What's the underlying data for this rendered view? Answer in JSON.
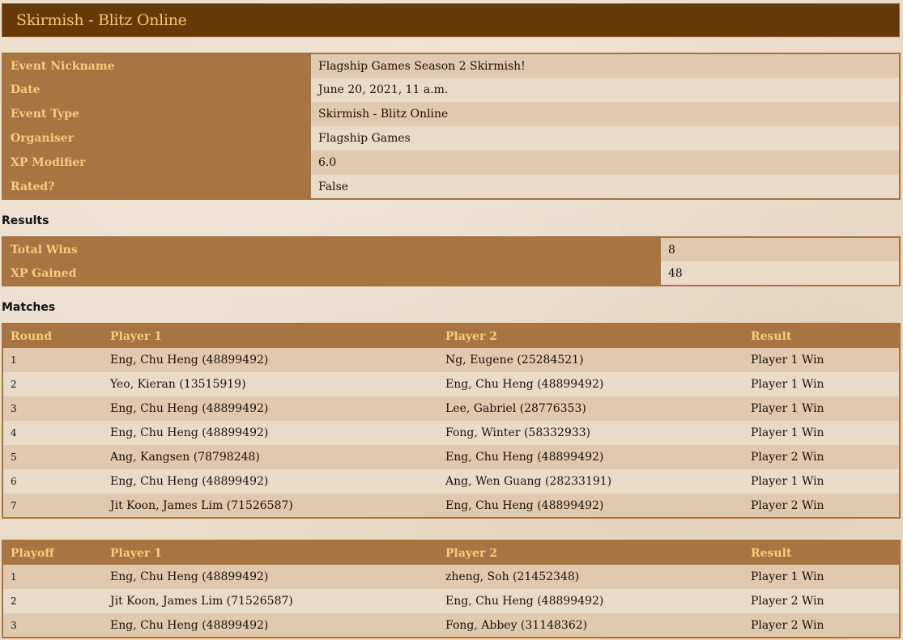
{
  "header": {
    "title": "Skirmish - Blitz Online"
  },
  "event": {
    "rows": [
      {
        "label": "Event Nickname",
        "value": "Flagship Games Season 2 Skirmish!"
      },
      {
        "label": "Date",
        "value": "June 20, 2021, 11 a.m."
      },
      {
        "label": "Event Type",
        "value": "Skirmish - Blitz Online"
      },
      {
        "label": "Organiser",
        "value": "Flagship Games"
      },
      {
        "label": "XP Modifier",
        "value": "6.0"
      },
      {
        "label": "Rated?",
        "value": "False"
      }
    ]
  },
  "results": {
    "title": "Results",
    "rows": [
      {
        "label": "Total Wins",
        "value": "8"
      },
      {
        "label": "XP Gained",
        "value": "48"
      }
    ]
  },
  "matches": {
    "title": "Matches",
    "headers": [
      "Round",
      "Player 1",
      "Player 2",
      "Result"
    ],
    "rows": [
      [
        "1",
        "Eng, Chu Heng (48899492)",
        "Ng, Eugene (25284521)",
        "Player 1 Win"
      ],
      [
        "2",
        "Yeo, Kieran (13515919)",
        "Eng, Chu Heng (48899492)",
        "Player 1 Win"
      ],
      [
        "3",
        "Eng, Chu Heng (48899492)",
        "Lee, Gabriel (28776353)",
        "Player 1 Win"
      ],
      [
        "4",
        "Eng, Chu Heng (48899492)",
        "Fong, Winter (58332933)",
        "Player 1 Win"
      ],
      [
        "5",
        "Ang, Kangsen (78798248)",
        "Eng, Chu Heng (48899492)",
        "Player 2 Win"
      ],
      [
        "6",
        "Eng, Chu Heng (48899492)",
        "Ang, Wen Guang (28233191)",
        "Player 1 Win"
      ],
      [
        "7",
        "Jit Koon, James Lim (71526587)",
        "Eng, Chu Heng (48899492)",
        "Player 2 Win"
      ]
    ]
  },
  "playoff": {
    "headers": [
      "Playoff",
      "Player 1",
      "Player 2",
      "Result"
    ],
    "rows": [
      [
        "1",
        "Eng, Chu Heng (48899492)",
        "zheng, Soh (21452348)",
        "Player 1 Win"
      ],
      [
        "2",
        "Jit Koon, James Lim (71526587)",
        "Eng, Chu Heng (48899492)",
        "Player 2 Win"
      ],
      [
        "3",
        "Eng, Chu Heng (48899492)",
        "Fong, Abbey (31148362)",
        "Player 2 Win"
      ]
    ]
  },
  "colors": {
    "header_bg": "#673808",
    "header_text": "#f4c573",
    "label_bg": "#a87442",
    "label_text": "#f6cc7c",
    "row_alt": "#e0c9ae",
    "page_bg": "#eadbc8"
  }
}
